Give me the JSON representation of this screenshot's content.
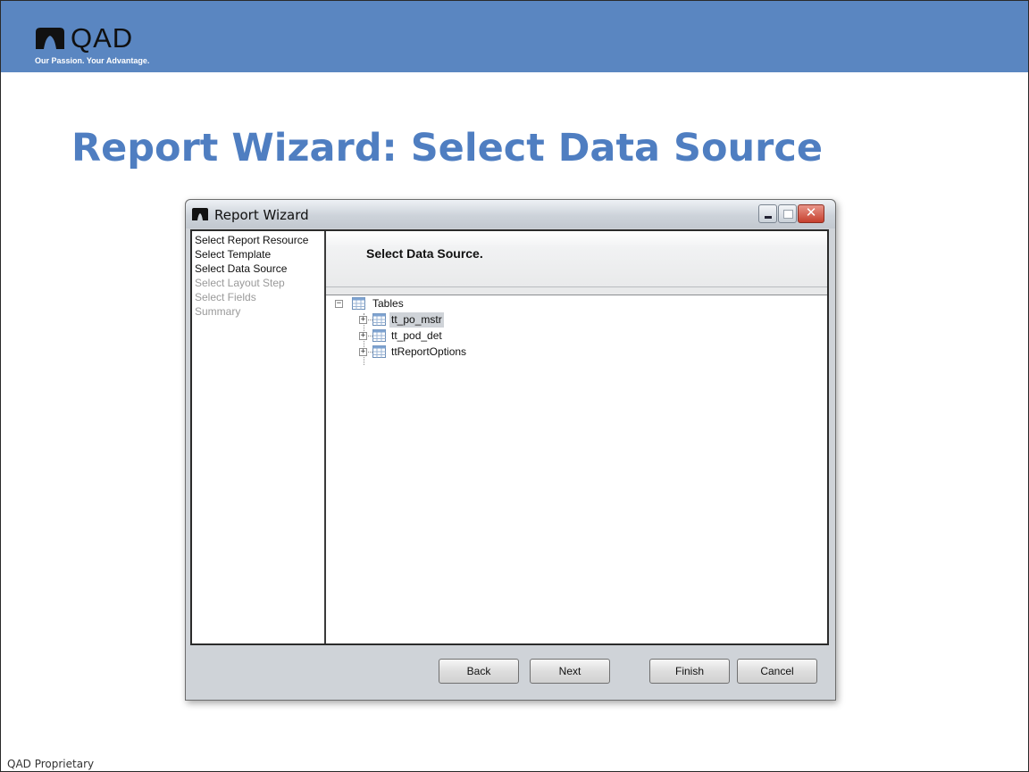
{
  "brand": {
    "name": "QAD",
    "tagline": "Our Passion. Your Advantage."
  },
  "slide_title": "Report Wizard: Select Data Source",
  "footer": "QAD Proprietary",
  "window": {
    "title": "Report Wizard",
    "close_glyph": "✕",
    "steps": [
      {
        "label": "Select Report Resource",
        "state": "done"
      },
      {
        "label": "Select Template",
        "state": "done"
      },
      {
        "label": "Select Data Source",
        "state": "current"
      },
      {
        "label": "Select Layout Step",
        "state": "disabled"
      },
      {
        "label": "Select Fields",
        "state": "disabled"
      },
      {
        "label": "Summary",
        "state": "disabled"
      }
    ],
    "header": "Select Data Source.",
    "tree": {
      "root": {
        "label": "Tables",
        "expanded": true
      },
      "children": [
        {
          "label": "tt_po_mstr",
          "selected": true
        },
        {
          "label": "tt_pod_det",
          "selected": false
        },
        {
          "label": "ttReportOptions",
          "selected": false
        }
      ],
      "expanded_glyph": "−",
      "collapsed_glyph": "+"
    },
    "buttons": {
      "back": "Back",
      "next": "Next",
      "finish": "Finish",
      "cancel": "Cancel"
    }
  },
  "colors": {
    "banner": "#5a86c1",
    "title": "#4f7ec1",
    "selection": "#cfd3d8"
  }
}
